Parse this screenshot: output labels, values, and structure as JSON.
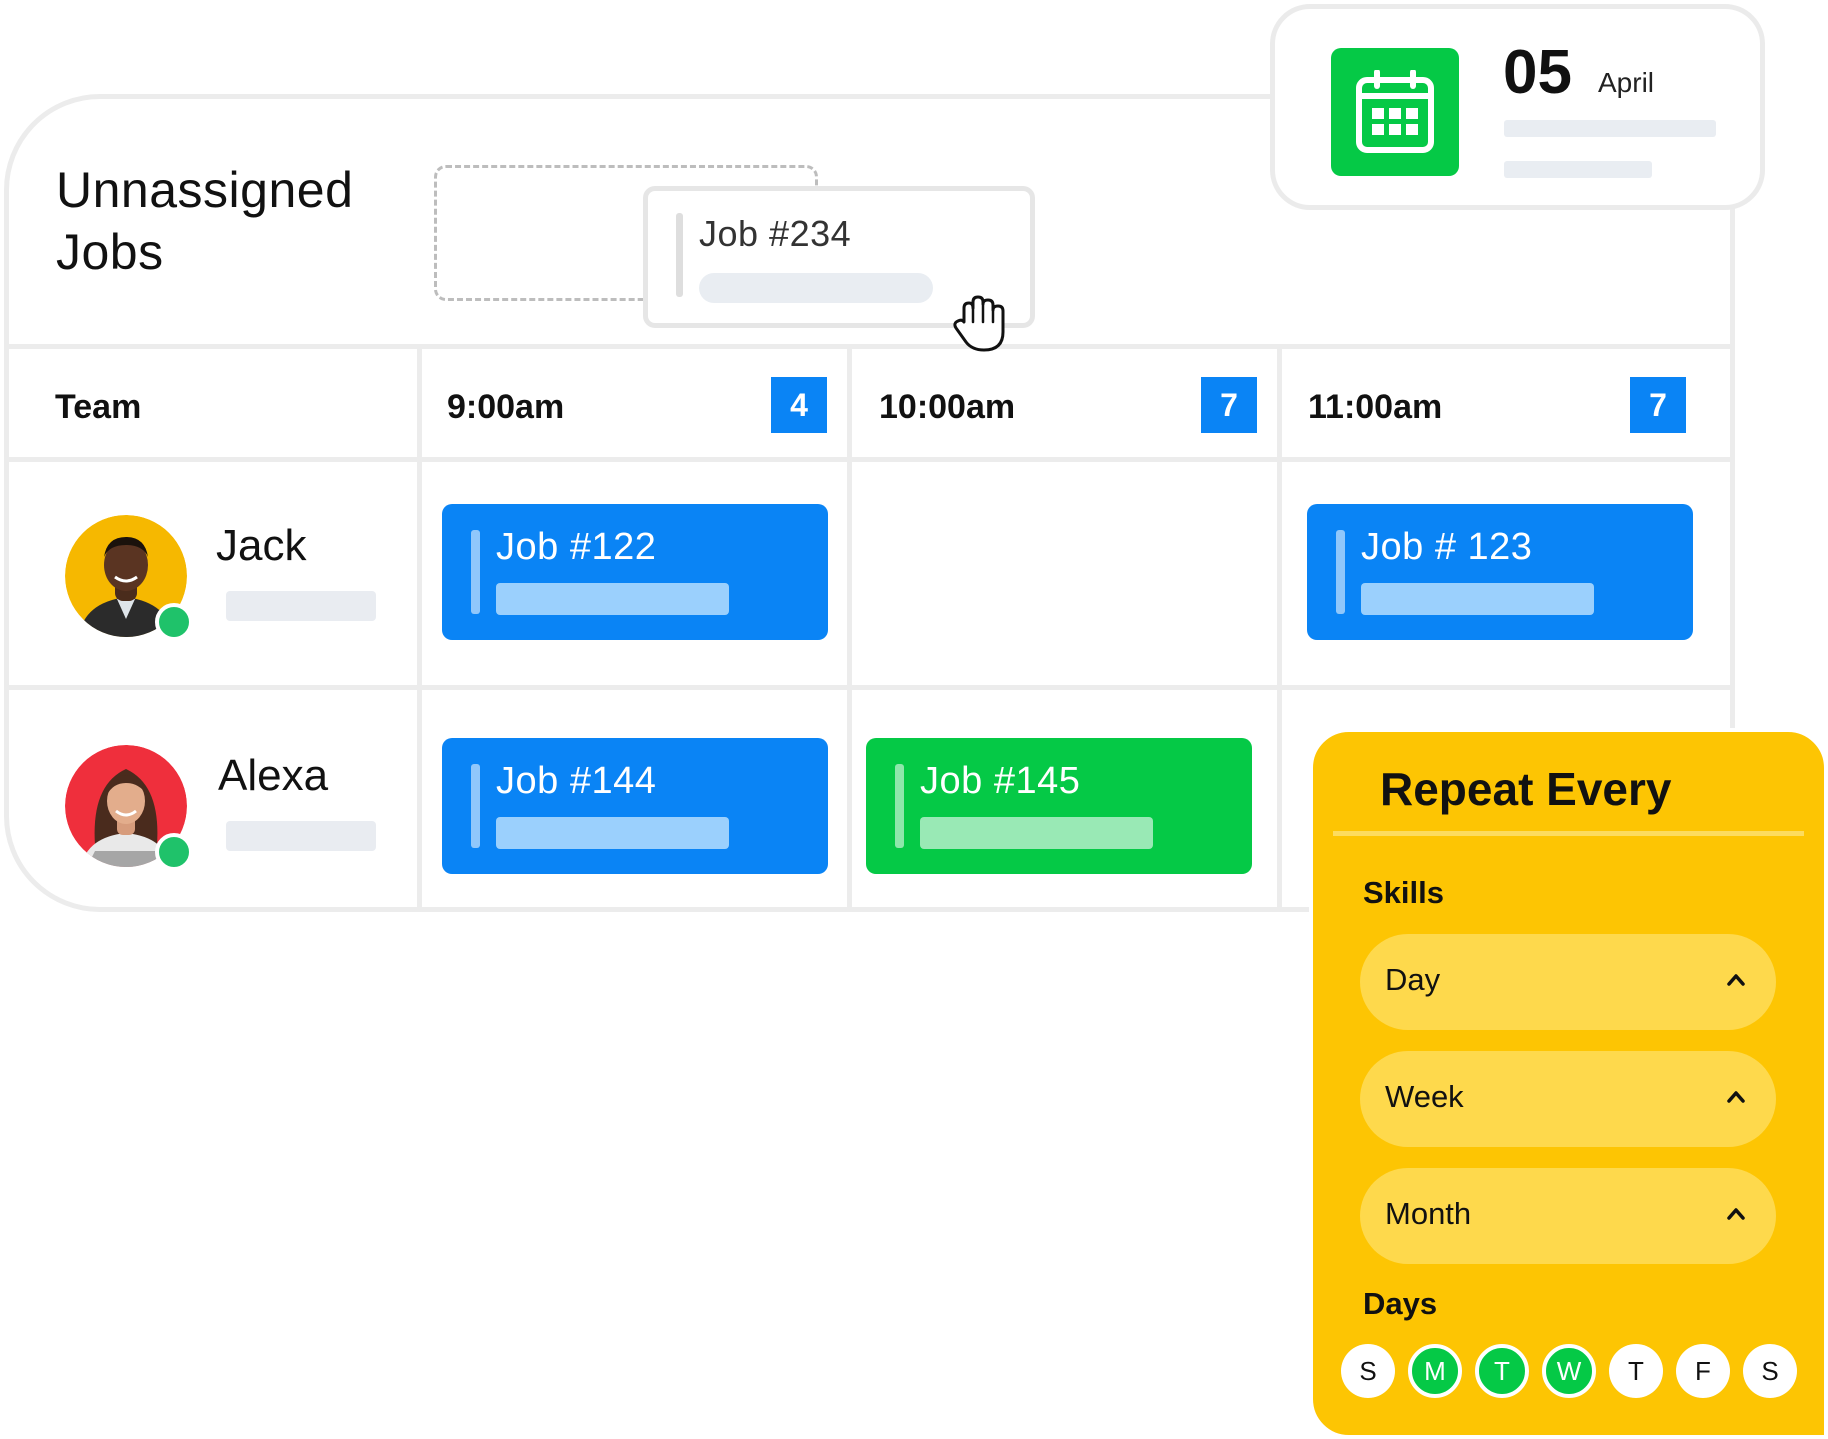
{
  "board": {
    "title": "Unnassigned Jobs",
    "team_header": "Team",
    "time_slots": [
      {
        "label": "9:00am",
        "count": "4"
      },
      {
        "label": "10:00am",
        "count": "7"
      },
      {
        "label": "11:00am",
        "count": "7"
      }
    ],
    "members": [
      {
        "name": "Jack",
        "status": "online"
      },
      {
        "name": "Alexa",
        "status": "online"
      }
    ],
    "jobs": [
      {
        "label": "Job #122",
        "member": "Jack",
        "slot": "9:00am",
        "color": "#0a84f5"
      },
      {
        "label": "Job # 123",
        "member": "Jack",
        "slot": "11:00am",
        "color": "#0a84f5"
      },
      {
        "label": "Job #144",
        "member": "Alexa",
        "slot": "9:00am",
        "color": "#0a84f5"
      },
      {
        "label": "Job #145",
        "member": "Alexa",
        "slot": "10:00am",
        "color": "#05c946"
      }
    ],
    "dragged_job": {
      "label": "Job #234"
    }
  },
  "date_card": {
    "day": "05",
    "month": "April",
    "icon": "calendar-icon"
  },
  "repeat_panel": {
    "title": "Repeat Every",
    "skills_label": "Skills",
    "options": [
      {
        "label": "Day"
      },
      {
        "label": "Week"
      },
      {
        "label": "Month"
      }
    ],
    "days_label": "Days",
    "days": [
      {
        "letter": "S",
        "selected": false
      },
      {
        "letter": "M",
        "selected": true
      },
      {
        "letter": "T",
        "selected": true
      },
      {
        "letter": "W",
        "selected": true
      },
      {
        "letter": "T",
        "selected": false
      },
      {
        "letter": "F",
        "selected": false
      },
      {
        "letter": "S",
        "selected": false
      }
    ]
  },
  "colors": {
    "accent_blue": "#0a84f5",
    "accent_green": "#05c946",
    "panel_yellow": "#fdc503",
    "online_green": "#1fc26a"
  }
}
